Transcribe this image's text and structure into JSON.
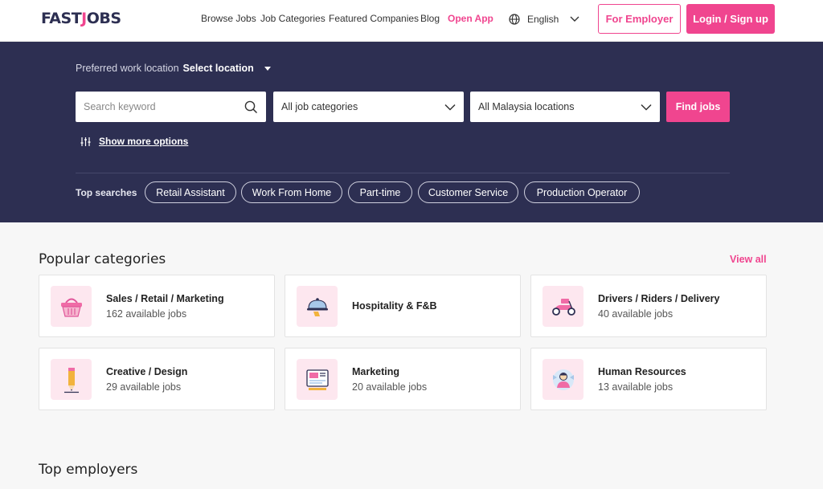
{
  "header": {
    "logo": "FASTJOBS",
    "nav": [
      "Browse Jobs",
      "Job Categories",
      "Featured Companies",
      "Blog",
      "Open App"
    ],
    "language": "English",
    "employer_label": "For Employer",
    "login_label": "Login / Sign up"
  },
  "hero": {
    "pref_label": "Preferred work location",
    "pref_value": "Select location",
    "search_placeholder": "Search keyword",
    "category_value": "All job categories",
    "location_value": "All Malaysia locations",
    "find_label": "Find jobs",
    "more_label": "Show more options",
    "top_label": "Top searches",
    "top_searches": [
      "Retail Assistant",
      "Work From Home",
      "Part-time",
      "Customer Service",
      "Production Operator"
    ]
  },
  "categories": {
    "title": "Popular categories",
    "view_all": "View all",
    "items": [
      {
        "title": "Sales / Retail / Marketing",
        "count": "162 available jobs",
        "icon": "basket-icon"
      },
      {
        "title": "Hospitality & F&B",
        "count": "",
        "icon": "cloche-icon"
      },
      {
        "title": "Drivers / Riders / Delivery",
        "count": "40 available jobs",
        "icon": "scooter-icon"
      },
      {
        "title": "Creative / Design",
        "count": "29 available jobs",
        "icon": "pencil-icon"
      },
      {
        "title": "Marketing",
        "count": "20 available jobs",
        "icon": "billboard-icon"
      },
      {
        "title": "Human Resources",
        "count": "13 available jobs",
        "icon": "person-icon"
      }
    ]
  },
  "employers": {
    "title": "Top employers"
  },
  "colors": {
    "accent": "#f0458f",
    "navy": "#2d2f52"
  }
}
